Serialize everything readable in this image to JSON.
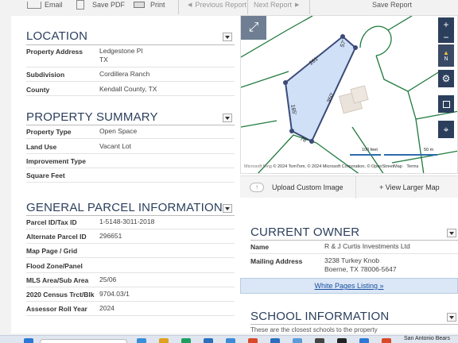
{
  "toolbar": {
    "email": "Email",
    "save_pdf": "Save PDF",
    "print": "Print",
    "previous": "Previous Report",
    "next": "Next Report",
    "save_report": "Save Report"
  },
  "location": {
    "title": "LOCATION",
    "rows": [
      {
        "label": "Property Address",
        "value_line1": "Ledgestone Pl",
        "value_line2": "TX"
      },
      {
        "label": "Subdivision",
        "value_line1": "Cordillera Ranch"
      },
      {
        "label": "County",
        "value_line1": "Kendall County, TX"
      }
    ]
  },
  "summary": {
    "title": "PROPERTY SUMMARY",
    "rows": [
      {
        "label": "Property Type",
        "value": "Open Space"
      },
      {
        "label": "Land Use",
        "value": "Vacant Lot"
      },
      {
        "label": "Improvement Type",
        "value": ""
      },
      {
        "label": "Square Feet",
        "value": ""
      }
    ]
  },
  "parcel": {
    "title": "GENERAL PARCEL INFORMATION",
    "rows": [
      {
        "label": "Parcel ID/Tax ID",
        "value": "1-5148-3011-2018"
      },
      {
        "label": "Alternate Parcel ID",
        "value": "296651"
      },
      {
        "label": "Map Page / Grid",
        "value": ""
      },
      {
        "label": "Flood Zone/Panel",
        "value": ""
      },
      {
        "label": "MLS Area/Sub Area",
        "value": "25/06"
      },
      {
        "label": "2020 Census Trct/Blk",
        "value": "9704.03/1"
      },
      {
        "label": "Assessor Roll Year",
        "value": "2024"
      }
    ]
  },
  "map": {
    "labels": {
      "top": "261'",
      "right": "350'",
      "left": "165'",
      "bottom": "78'",
      "corner": "57'"
    },
    "zoom_in": "+",
    "zoom_out": "−",
    "compass": "N",
    "scale_ft": "100 feet",
    "scale_m": "50 m",
    "attribution": "© 2024 TomTom, © 2024 Microsoft Corporation, © OpenStreetMap",
    "terms": "Terms",
    "brand": "Microsoft Bing",
    "upload": "Upload Custom Image",
    "larger": "+ View Larger Map",
    "colors": {
      "parcel_fill": "#cfe0f7",
      "parcel_stroke": "#3b4a78",
      "lines": "#1e7a3c"
    }
  },
  "owner": {
    "title": "CURRENT OWNER",
    "name_label": "Name",
    "name": "R & J Curtis Investments Ltd",
    "address_label": "Mailing Address",
    "address_line1": "3238 Turkey Knob",
    "address_line2": "Boerne, TX 78006-5647",
    "white_pages": "White Pages Listing »"
  },
  "school": {
    "title": "SCHOOL INFORMATION",
    "subtitle": "These are the closest schools to the property"
  },
  "taskbar": {
    "weather": "San Antonio Bears"
  }
}
